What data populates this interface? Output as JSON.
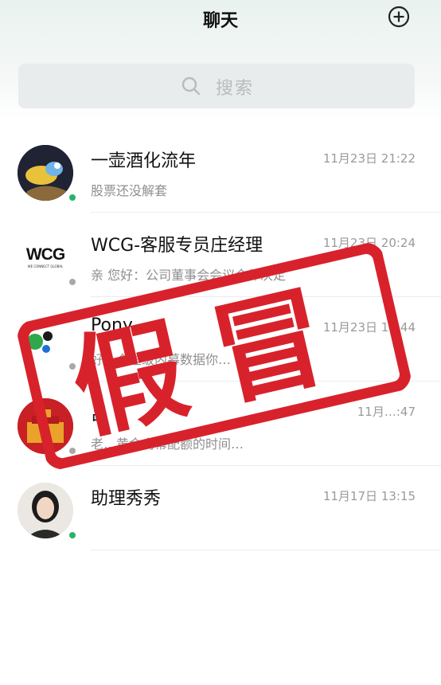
{
  "header": {
    "title": "聊天"
  },
  "search": {
    "placeholder": "搜索"
  },
  "chats": [
    {
      "name": "一壶酒化流年",
      "time": "11月23日 21:22",
      "message": "股票还没解套",
      "online": true
    },
    {
      "name": "WCG-客服专员庄经理",
      "time": "11月23日 20:24",
      "message": "亲 您好：公司董事会会议全体决定",
      "online": false,
      "avatar_text": "WCG",
      "avatar_sub": "WE CONNECT GLOBAL"
    },
    {
      "name": "Pony",
      "time": "11月23日 13:44",
      "message": "好一个超级内幕数据你…",
      "online": false
    },
    {
      "name": "吕",
      "time": "11月…:47",
      "message": "老…黄金内幕配额的时间…",
      "online": false
    },
    {
      "name": "助理秀秀",
      "time": "11月17日 13:15",
      "message": "",
      "online": true
    }
  ],
  "stamp": {
    "text": "假冒"
  },
  "colors": {
    "online": "#27b36a",
    "offline": "#a8a8a8",
    "stamp": "#d8222b"
  }
}
